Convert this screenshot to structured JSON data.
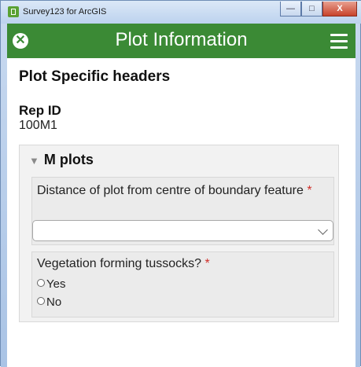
{
  "window": {
    "title": "Survey123 for ArcGIS",
    "buttons": {
      "minimize": "—",
      "maximize": "□",
      "close": "X"
    }
  },
  "app": {
    "title": "Plot Information",
    "theme_color": "#3b8a35"
  },
  "form": {
    "section_header": "Plot Specific headers",
    "rep_id": {
      "label": "Rep ID",
      "value": "100M1"
    },
    "group": {
      "title": "M plots",
      "questions": [
        {
          "label": "Distance of plot from centre of boundary feature",
          "required_marker": "*",
          "value": ""
        },
        {
          "label": "Vegetation forming tussocks?",
          "required_marker": "*",
          "options": [
            "Yes",
            "No"
          ]
        }
      ]
    }
  },
  "colors": {
    "required": "#d0302a"
  }
}
